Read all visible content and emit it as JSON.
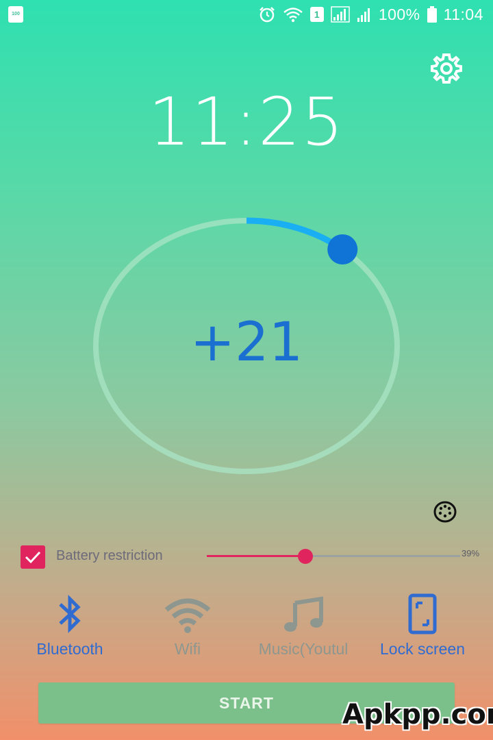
{
  "status_bar": {
    "left_badge": "100",
    "sim_badge": "1",
    "battery_text": "100%",
    "time": "11:04",
    "icons": [
      "alarm-icon",
      "wifi-icon",
      "sim-icon",
      "signal-icon",
      "signal-icon",
      "battery-icon"
    ]
  },
  "settings_icon": "gear-icon",
  "clock": {
    "time": "11:25"
  },
  "dial": {
    "value_text": "+21",
    "progress_fraction": 0.11,
    "colors": {
      "track": "#a9e4c6",
      "arc": "#1aaef2",
      "knob": "#0f74d6"
    }
  },
  "mask_icon": "mask-icon",
  "battery_restriction": {
    "label": "Battery restriction",
    "checked": true,
    "slider_value": 0.39,
    "percent_text": "39%",
    "accent": "#e0245e"
  },
  "features": [
    {
      "label": "Bluetooth",
      "icon": "bluetooth-icon",
      "active": true,
      "color": "#2f6bd0"
    },
    {
      "label": "Wifi",
      "icon": "wifi-icon",
      "active": false,
      "color": "#8e978f"
    },
    {
      "label": "Music(Youtul",
      "icon": "music-icon",
      "active": false,
      "color": "#8e978f"
    },
    {
      "label": "Lock screen",
      "icon": "phone-lock-icon",
      "active": true,
      "color": "#2f6bd0"
    }
  ],
  "start_button": {
    "label": "START"
  },
  "watermark": {
    "text": "Apkpp.com"
  }
}
